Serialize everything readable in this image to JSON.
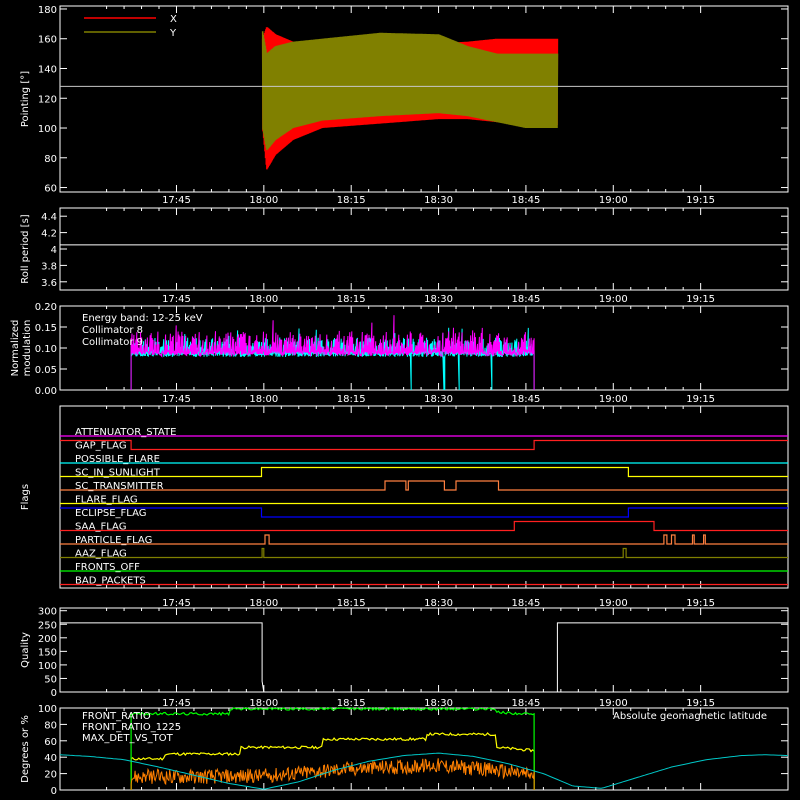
{
  "time_axis": {
    "start_min": 1045,
    "end_min": 1170,
    "tick_labels": [
      "17:45",
      "18:00",
      "18:15",
      "18:30",
      "18:45",
      "19:00",
      "19:15"
    ],
    "tick_min": [
      1065,
      1080,
      1095,
      1110,
      1125,
      1140,
      1155
    ]
  },
  "chart_data": [
    {
      "type": "line",
      "ylabel": "Pointing [°]",
      "ylim": [
        57,
        182
      ],
      "yticks": [
        60,
        80,
        100,
        120,
        140,
        160,
        180
      ],
      "legend": [
        {
          "name": "X",
          "color": "#ff0000"
        },
        {
          "name": "Y",
          "color": "#808000"
        }
      ],
      "reference_line": 128,
      "data_start_min": 1079.8,
      "data_end_min": 1130.4,
      "series": [
        {
          "name": "X",
          "color": "#ff0000",
          "envelope_x": [
            1079.8,
            1080.5,
            1082,
            1085,
            1090,
            1100,
            1110,
            1115,
            1120,
            1125,
            1130.4
          ],
          "upper": [
            160,
            168,
            163,
            158,
            157,
            157,
            157,
            158,
            160,
            160,
            160
          ],
          "lower": [
            100,
            72,
            82,
            92,
            100,
            103,
            106,
            106,
            104,
            102,
            102
          ]
        },
        {
          "name": "Y",
          "color": "#808000",
          "envelope_x": [
            1079.8,
            1080.5,
            1082,
            1085,
            1090,
            1100,
            1110,
            1115,
            1120,
            1125,
            1130.4
          ],
          "upper": [
            165,
            150,
            155,
            158,
            160,
            164,
            163,
            155,
            150,
            150,
            150
          ],
          "lower": [
            100,
            85,
            92,
            100,
            105,
            108,
            110,
            108,
            104,
            100,
            100
          ]
        }
      ]
    },
    {
      "type": "line",
      "ylabel": "Roll period [s]",
      "ylim": [
        3.5,
        4.5
      ],
      "yticks": [
        3.6,
        3.8,
        4.0,
        4.2,
        4.4
      ],
      "series": [
        {
          "color": "#ffffff",
          "x": [
            1045,
            1170
          ],
          "y": [
            4.05,
            4.05
          ]
        }
      ]
    },
    {
      "type": "line",
      "ylabel": "Normalized modulation",
      "ylabel_lines": [
        "Normalized",
        "modulation"
      ],
      "ylim": [
        0,
        0.2
      ],
      "yticks": [
        0.0,
        0.05,
        0.1,
        0.15,
        0.2
      ],
      "ytick_labels": [
        "0.00",
        "0.05",
        "0.10",
        "0.15",
        "0.20"
      ],
      "annotation": "Energy band: 12-25 keV",
      "data_start_min": 1057.2,
      "data_end_min": 1126.4,
      "series": [
        {
          "name": "Collimator 8",
          "color": "#00ffff",
          "base": 0.105,
          "spread": 0.02,
          "dropouts_min": [
            1105.3,
            1111.0,
            1113.5,
            1119.2
          ]
        },
        {
          "name": "Collimator 9",
          "color": "#ff00ff",
          "base": 0.11,
          "spread": 0.03,
          "dropouts_min": []
        }
      ]
    },
    {
      "type": "line",
      "ylabel": "Flags",
      "flags": [
        {
          "name": "ATTENUATOR_STATE",
          "color": "#ff00ff",
          "steps": [
            [
              1045,
              0
            ]
          ]
        },
        {
          "name": "GAP_FLAG",
          "color": "#ff2020",
          "steps": [
            [
              1045,
              1
            ],
            [
              1057.2,
              0
            ],
            [
              1126.4,
              1
            ]
          ]
        },
        {
          "name": "POSSIBLE_FLARE",
          "color": "#00ffff",
          "steps": [
            [
              1045,
              0
            ]
          ]
        },
        {
          "name": "SC_IN_SUNLIGHT",
          "color": "#ffff00",
          "steps": [
            [
              1045,
              0
            ],
            [
              1079.6,
              1
            ],
            [
              1142.6,
              0
            ]
          ]
        },
        {
          "name": "SC_TRANSMITTER",
          "color": "#ff8040",
          "steps": [
            [
              1045,
              0
            ],
            [
              1100.8,
              1
            ],
            [
              1104.4,
              0
            ],
            [
              1104.8,
              1
            ],
            [
              1111.0,
              0
            ],
            [
              1113.0,
              1
            ],
            [
              1120.3,
              0
            ]
          ]
        },
        {
          "name": "FLARE_FLAG",
          "color": "#ffff00",
          "steps": [
            [
              1045,
              0
            ]
          ]
        },
        {
          "name": "ECLIPSE_FLAG",
          "color": "#0000ff",
          "steps": [
            [
              1045,
              1
            ],
            [
              1079.6,
              0
            ],
            [
              1142.6,
              1
            ]
          ]
        },
        {
          "name": "SAA_FLAG",
          "color": "#ff2020",
          "steps": [
            [
              1045,
              0
            ],
            [
              1123.0,
              1
            ],
            [
              1147.0,
              0
            ]
          ]
        },
        {
          "name": "PARTICLE_FLAG",
          "color": "#ff8040",
          "steps": [
            [
              1045,
              0
            ],
            [
              1080.2,
              1
            ],
            [
              1080.9,
              0
            ],
            [
              1148.7,
              1
            ],
            [
              1149.2,
              0
            ],
            [
              1150.0,
              1
            ],
            [
              1150.6,
              0
            ],
            [
              1153.6,
              1
            ],
            [
              1153.9,
              0
            ],
            [
              1155.5,
              1
            ],
            [
              1155.8,
              0
            ]
          ]
        },
        {
          "name": "AAZ_FLAG",
          "color": "#808000",
          "steps": [
            [
              1045,
              0
            ],
            [
              1079.7,
              1
            ],
            [
              1080.0,
              0
            ],
            [
              1141.7,
              1
            ],
            [
              1142.2,
              0
            ]
          ]
        },
        {
          "name": "FRONTS_OFF",
          "color": "#00ff00",
          "steps": [
            [
              1045,
              0
            ]
          ]
        },
        {
          "name": "BAD_PACKETS",
          "color": "#ff2020",
          "steps": [
            [
              1045,
              0
            ]
          ]
        }
      ]
    },
    {
      "type": "line",
      "ylabel": "Quality",
      "ylim": [
        0,
        310
      ],
      "yticks": [
        0,
        50,
        100,
        150,
        200,
        250,
        300
      ],
      "series": [
        {
          "color": "#ffffff",
          "x": [
            1045,
            1079.7,
            1079.7,
            1080.0,
            1080.0,
            1130.4,
            1130.4,
            1170
          ],
          "y": [
            255,
            255,
            40,
            0,
            0,
            0,
            255,
            255
          ]
        }
      ]
    },
    {
      "type": "line",
      "ylabel": "Degrees or %",
      "ylim": [
        0,
        100
      ],
      "yticks": [
        0,
        20,
        40,
        60,
        80,
        100
      ],
      "annotation": "Absolute geomagnetic latitude",
      "series": [
        {
          "name": "FRONT_RATIO",
          "color": "#ffff00",
          "x": [
            1057.2,
            1063,
            1063,
            1076,
            1076,
            1090,
            1090,
            1108,
            1108,
            1120,
            1120,
            1126.4
          ],
          "y": [
            38,
            38,
            44,
            44,
            52,
            52,
            62,
            62,
            68,
            68,
            52,
            48
          ]
        },
        {
          "name": "FRONT_RATIO_1225",
          "color": "#00ff00",
          "x": [
            1057.2,
            1074,
            1074,
            1120,
            1120,
            1126.4
          ],
          "y": [
            93,
            93,
            99,
            99,
            95,
            92
          ]
        },
        {
          "name": "MAX_DET_VS_TOT",
          "color": "#ff8000",
          "x": [
            1057.2,
            1080,
            1095,
            1110,
            1120,
            1126.4
          ],
          "y": [
            16,
            17,
            26,
            30,
            24,
            18
          ]
        },
        {
          "name": "Absolute geomagnetic latitude",
          "color": "#00c8c8",
          "x": [
            1045,
            1050,
            1056,
            1062,
            1068,
            1074,
            1080,
            1086,
            1092,
            1098,
            1104,
            1110,
            1116,
            1122,
            1128,
            1133,
            1138,
            1144,
            1150,
            1156,
            1162,
            1166,
            1170
          ],
          "y": [
            43,
            41,
            37,
            28,
            18,
            8,
            1,
            10,
            24,
            35,
            42,
            45,
            41,
            32,
            20,
            5,
            2,
            15,
            28,
            37,
            42,
            43,
            42
          ]
        }
      ]
    }
  ]
}
